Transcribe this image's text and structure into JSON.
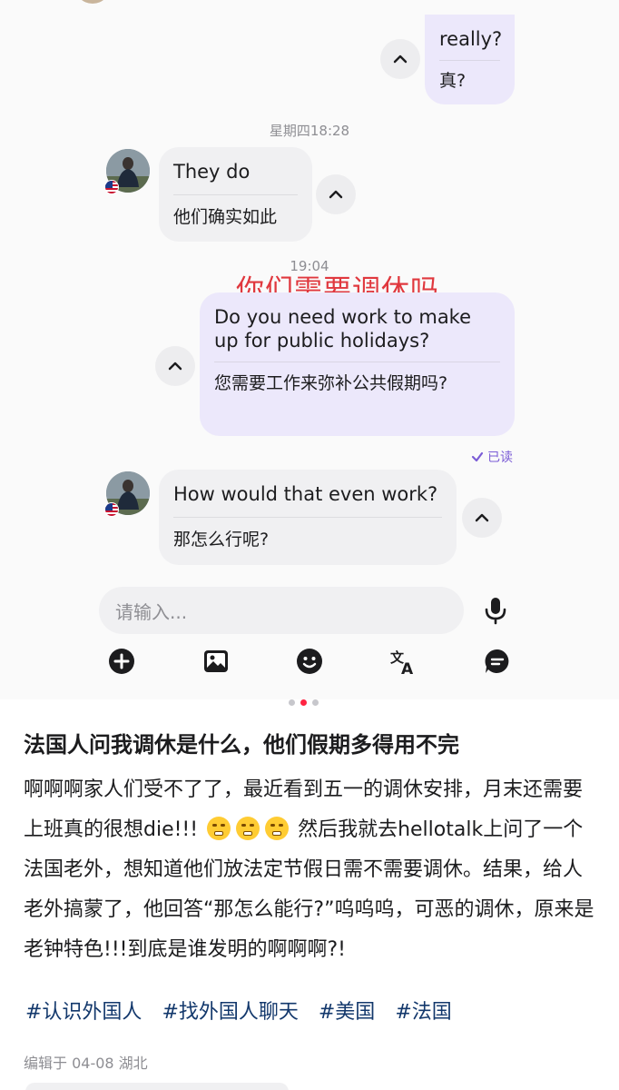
{
  "chat": {
    "messages": [
      {
        "side": "out",
        "original": "really?",
        "translation": "真?"
      },
      {
        "side": "in",
        "original": "They do",
        "translation": "他们确实如此"
      },
      {
        "side": "out",
        "original": "Do you need work to make up for public holidays?",
        "translation": "您需要工作来弥补公共假期吗?"
      },
      {
        "side": "in",
        "original": "How would that even work?",
        "translation": "那怎么行呢?"
      }
    ],
    "timestamps": [
      "星期四18:28",
      "19:04"
    ],
    "overlay_annotation": "你们需要调休吗",
    "read_status": "已读",
    "input_placeholder": "请输入...",
    "toolbar_icons": [
      "add-icon",
      "image-icon",
      "emoji-icon",
      "translate-icon",
      "quick-reply-icon",
      "microphone-icon"
    ],
    "page_dots": {
      "count": 3,
      "active": 2
    }
  },
  "post": {
    "title": "法国人问我调休是什么，他们假期多得用不完",
    "body_part1": "啊啊啊家人们受不了了，最近看到五一的调休安排，月末还需要上班真的很想die!!!",
    "body_part2": "然后我就去hellotalk上问了一个法国老外，想知道他们放法定节假日需不需要调休。结果，给人老外搞蒙了，他回答“那怎么能行?”呜呜呜，可恶的调休，原来是老钟特色!!!到底是谁发明的啊啊啊?!",
    "tags": [
      "#认识外国人",
      "#找外国人聊天",
      "#美国",
      "#法国"
    ],
    "meta": "编辑于 04-08 湖北"
  },
  "colors": {
    "outgoing_bubble": "#ece8fb",
    "incoming_bubble": "#f0f0f2",
    "overlay_red": "#e0383e",
    "read_purple": "#7b5cd6",
    "tag_blue": "#13386c",
    "active_dot": "#ff2442"
  }
}
